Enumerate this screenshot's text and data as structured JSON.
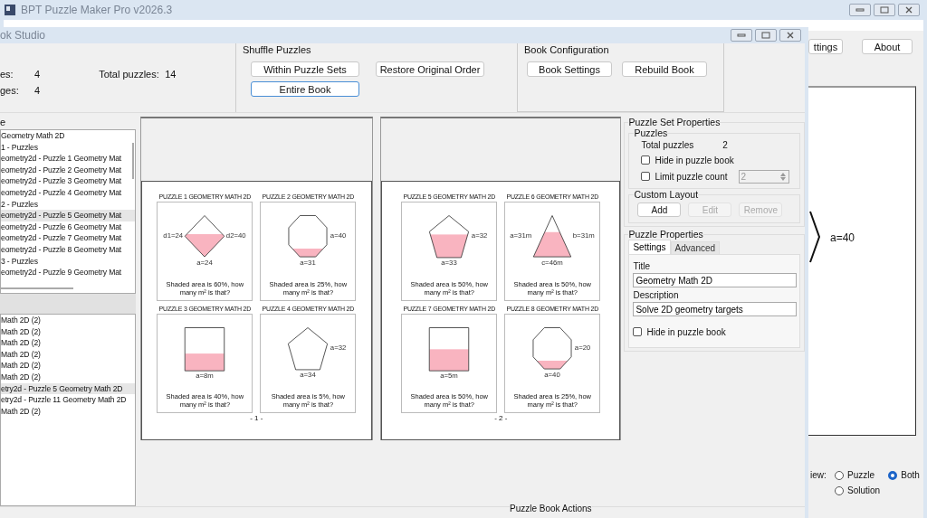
{
  "app": {
    "title": "BPT Puzzle Maker Pro v2026.3",
    "toolbar": [
      {
        "label": "ttings"
      },
      {
        "label": "About"
      }
    ],
    "preview": {
      "label": "a=40"
    },
    "view": {
      "label": "iew:",
      "options": [
        {
          "label": "Puzzle",
          "selected": false
        },
        {
          "label": "Both",
          "selected": true
        },
        {
          "label": "Solution",
          "selected": false
        }
      ]
    }
  },
  "studio": {
    "title": "ok Studio",
    "stats": [
      {
        "label": "es:",
        "value": "4"
      },
      {
        "label": "ges:",
        "value": "4"
      }
    ],
    "total": {
      "label": "Total puzzles:",
      "value": "14"
    },
    "shuffle": {
      "title": "Shuffle Puzzles",
      "buttons": [
        {
          "label": "Within Puzzle Sets",
          "focused": false
        },
        {
          "label": "Restore Original Order",
          "focused": false
        },
        {
          "label": "Entire Book",
          "focused": true
        }
      ]
    },
    "config": {
      "title": "Book Configuration",
      "buttons": [
        {
          "label": "Book Settings",
          "focused": false
        },
        {
          "label": "Rebuild Book",
          "focused": false
        }
      ]
    },
    "tree": {
      "label": "e",
      "items": [
        {
          "label": "Geometry Math 2D",
          "selected": false
        },
        {
          "label": "1 - Puzzles",
          "selected": false
        },
        {
          "label": "eometry2d - Puzzle 1 Geometry Mat",
          "selected": false
        },
        {
          "label": "eometry2d - Puzzle 2 Geometry Mat",
          "selected": false
        },
        {
          "label": "eometry2d - Puzzle 3 Geometry Mat",
          "selected": false
        },
        {
          "label": "eometry2d - Puzzle 4 Geometry Mat",
          "selected": false
        },
        {
          "label": "2 - Puzzles",
          "selected": false
        },
        {
          "label": "eometry2d - Puzzle 5 Geometry Mat",
          "selected": true
        },
        {
          "label": "eometry2d - Puzzle 6 Geometry Mat",
          "selected": false
        },
        {
          "label": "eometry2d - Puzzle 7 Geometry Mat",
          "selected": false
        },
        {
          "label": "eometry2d - Puzzle 8 Geometry Mat",
          "selected": false
        },
        {
          "label": "3 - Puzzles",
          "selected": false
        },
        {
          "label": "eometry2d - Puzzle 9 Geometry Mat",
          "selected": false
        }
      ]
    },
    "list": {
      "items": [
        {
          "label": "Math 2D (2)",
          "selected": false
        },
        {
          "label": "Math 2D (2)",
          "selected": false
        },
        {
          "label": "Math 2D (2)",
          "selected": false
        },
        {
          "label": "Math 2D (2)",
          "selected": false
        },
        {
          "label": "Math 2D (2)",
          "selected": false
        },
        {
          "label": "Math 2D (2)",
          "selected": false
        },
        {
          "label": "etry2d - Puzzle 5 Geometry Math 2D",
          "selected": true
        },
        {
          "label": "etry2d - Puzzle 11 Geometry Math 2D",
          "selected": false
        },
        {
          "label": "Math 2D (2)",
          "selected": false
        }
      ]
    },
    "pages": [
      {
        "number": "- 1 -",
        "puzzles": [
          {
            "title": "PUZZLE 1 GEOMETRY MATH 2D",
            "kind": "diamond",
            "level": 0.55,
            "labels": [
              "d1=24",
              "d2=40",
              "a=24"
            ],
            "question": "Shaded area is 60%, how many m² is that?"
          },
          {
            "title": "PUZZLE 2 GEOMETRY MATH 2D",
            "kind": "octagon",
            "level": 0.2,
            "labels": [
              "a=40",
              "a=31"
            ],
            "question": "Shaded area is 25%, how many m² is that?"
          },
          {
            "title": "PUZZLE 3 GEOMETRY MATH 2D",
            "kind": "square",
            "level": 0.4,
            "labels": [
              "a=8m"
            ],
            "question": "Shaded area is 40%, how many m² is that?"
          },
          {
            "title": "PUZZLE 4 GEOMETRY MATH 2D",
            "kind": "pentagon",
            "labels": [
              "a=32",
              "a=34"
            ],
            "question": "Shaded area is 5%, how many m² is that?"
          }
        ]
      },
      {
        "number": "- 2 -",
        "puzzles": [
          {
            "title": "PUZZLE 5 GEOMETRY MATH 2D",
            "kind": "pentagon",
            "level": 0.55,
            "labels": [
              "a=32",
              "a=33"
            ],
            "question": "Shaded area is 50%, how many m² is that?"
          },
          {
            "title": "PUZZLE 6 GEOMETRY MATH 2D",
            "kind": "triangle",
            "level": 0.6,
            "labels": [
              "a=31m",
              "b=31m",
              "c=46m"
            ],
            "question": "Shaded area is 50%, how many m² is that?"
          },
          {
            "title": "PUZZLE 7 GEOMETRY MATH 2D",
            "kind": "square",
            "level": 0.5,
            "labels": [
              "a=5m"
            ],
            "question": "Shaded area is 50%, how many m² is that?"
          },
          {
            "title": "PUZZLE 8 GEOMETRY MATH 2D",
            "kind": "octagon",
            "level": 0.2,
            "labels": [
              "a=20",
              "a=40"
            ],
            "question": "Shaded area is 25%, how many m² is that?"
          }
        ]
      }
    ],
    "set_props": {
      "title": "Puzzle Set Properties",
      "puzzles_title": "Puzzles",
      "total_label": "Total puzzles",
      "total_value": "2",
      "hide": {
        "label": "Hide in puzzle book",
        "checked": false
      },
      "limit": {
        "label": "Limit puzzle count",
        "checked": false,
        "value": "2"
      },
      "layout_title": "Custom Layout",
      "layout_buttons": [
        {
          "label": "Add",
          "disabled": false
        },
        {
          "label": "Edit",
          "disabled": true
        },
        {
          "label": "Remove",
          "disabled": true
        }
      ]
    },
    "puzzle_props": {
      "title": "Puzzle Properties",
      "tabs": [
        {
          "label": "Settings",
          "selected": true
        },
        {
          "label": "Advanced",
          "selected": false
        }
      ],
      "title_label": "Title",
      "title_value": "Geometry Math 2D",
      "desc_label": "Description",
      "desc_value": "Solve 2D geometry targets",
      "hide": {
        "label": "Hide in puzzle book",
        "checked": false
      }
    },
    "actions_title": "Puzzle Book Actions"
  }
}
